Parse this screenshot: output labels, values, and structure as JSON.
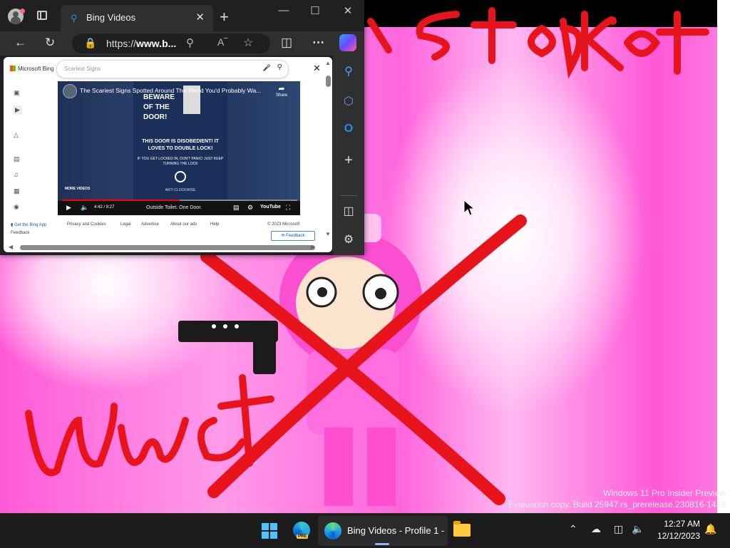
{
  "desktop": {
    "watermark_line1": "Windows 11 Pro Insider Preview",
    "watermark_line2": "Evaluation copy. Build 25947.rs_prerelease.230816-1416",
    "scribble_top": "I stop ket",
    "scribble_bottom": "Uwu ct"
  },
  "browser": {
    "tab_title": "Bing Videos",
    "new_tab_icon": "+",
    "url_prefix": "https://",
    "url_host": "www.b...",
    "page": {
      "logo_text": "Microsoft Bing",
      "search_placeholder": "Scariest Signs",
      "video": {
        "title": "The Scariest Signs Spotted Around The World You'd Probably Wa...",
        "share_label": "Share",
        "poster_beware": "BEWARE OF THE DOOR!",
        "poster_main": "THIS DOOR IS DISOBEDIENT! IT LOVES TO DOUBLE LOCK!",
        "poster_sub": "IF YOU GET LOCKED IN, DON'T PANIC! JUST KEEP TURNING THE LOCK",
        "poster_anti": "ANTI CLOCKWISE",
        "more_videos": "MORE VIDEOS",
        "time": "4:42 / 9:27",
        "caption": "Outside Toilet. One Door.",
        "brand": "YouTube",
        "progress_fraction": 0.5
      },
      "footer": {
        "get_app": "Get the Bing App",
        "privacy": "Privacy and Cookies",
        "legal": "Legal",
        "advertise": "Advertise",
        "about_ads": "About our ads",
        "help": "Help",
        "copyright": "© 2023 Microsoft",
        "feedback_link": "Feedback",
        "feedback_button": "Feedback"
      }
    }
  },
  "taskbar": {
    "pre_badge": "PRE",
    "edge_app_label": "Bing Videos - Profile 1 -",
    "time": "12:27 AM",
    "date": "12/12/2023"
  },
  "colors": {
    "accent": "#4cc2ff",
    "wallpaper_pink": "#ff5ad8",
    "scribble_red": "#e8141c"
  }
}
